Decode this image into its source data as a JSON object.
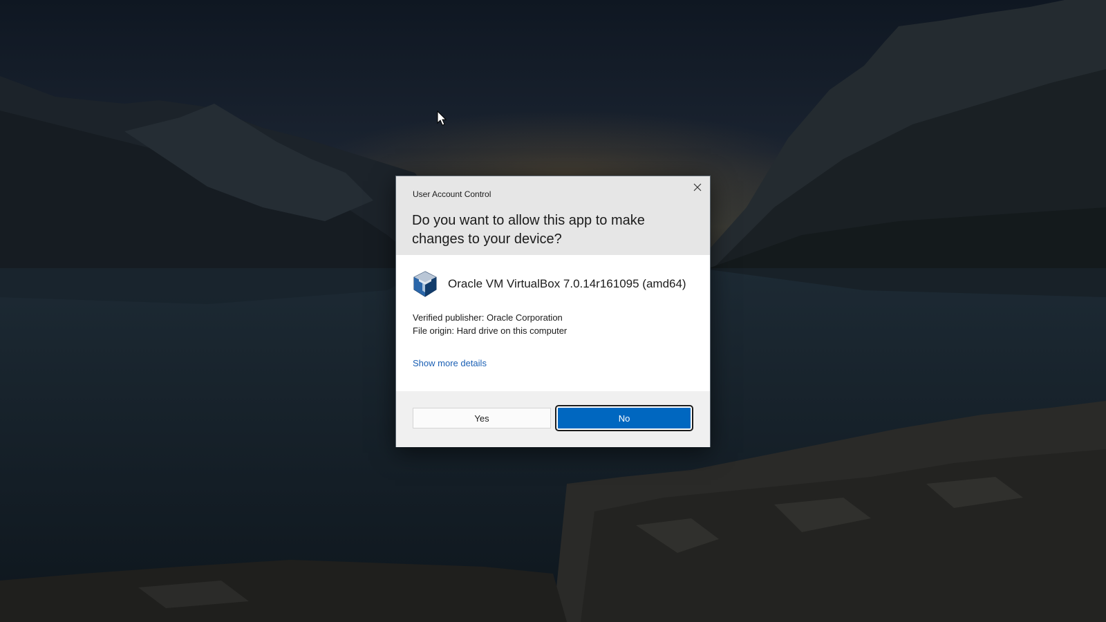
{
  "dialog": {
    "title": "User Account Control",
    "question": "Do you want to allow this app to make changes to your device?",
    "app_name": "Oracle VM VirtualBox 7.0.14r161095 (amd64)",
    "app_icon": "virtualbox-cube-icon",
    "publisher": "Verified publisher: Oracle Corporation",
    "origin": "File origin: Hard drive on this computer",
    "more_details": "Show more details",
    "buttons": {
      "yes": "Yes",
      "no": "No"
    },
    "close_icon": "close-icon"
  },
  "colors": {
    "primary_button": "#0067c0",
    "link": "#1a5fb4",
    "header_bg": "#e6e6e6",
    "footer_bg": "#f0f0f0"
  }
}
